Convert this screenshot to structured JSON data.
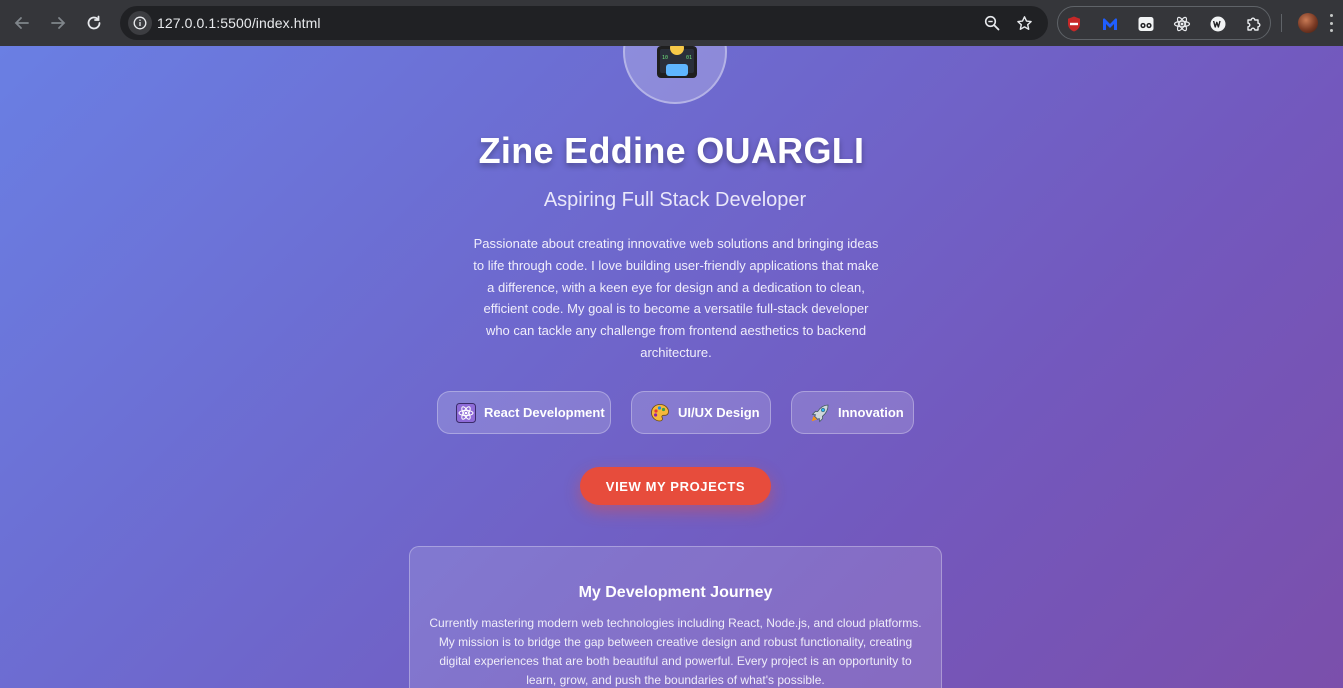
{
  "browser": {
    "url": "127.0.0.1:5500/index.html",
    "icons": {
      "back": "arrow-left-icon",
      "forward": "arrow-right-icon",
      "reload": "reload-icon",
      "site_info": "info-icon",
      "zoom": "zoom-icon",
      "bookmark": "star-icon",
      "extensions": [
        "adblock-icon",
        "malwarebytes-icon",
        "eyes-extension-icon",
        "react-devtools-icon",
        "w-extension-icon",
        "puzzle-icon"
      ],
      "profile": "avatar",
      "menu": "kebab-menu-icon"
    }
  },
  "hero": {
    "avatar_emoji": "technologist-emoji",
    "name": "Zine Eddine OUARGLI",
    "title": "Aspiring Full Stack Developer",
    "description": "Passionate about creating innovative web solutions and bringing ideas to life through code. I love building user-friendly applications that make a difference, with a keen eye for design and a dedication to clean, efficient code. My goal is to become a versatile full-stack developer who can tackle any challenge from frontend aesthetics to backend architecture."
  },
  "skills": [
    {
      "icon": "atom-icon",
      "label": "React Development"
    },
    {
      "icon": "palette-icon",
      "label": "UI/UX Design"
    },
    {
      "icon": "rocket-icon",
      "label": "Innovation"
    }
  ],
  "cta": {
    "label": "VIEW MY PROJECTS"
  },
  "journey": {
    "title": "My Development Journey",
    "text": "Currently mastering modern web technologies including React, Node.js, and cloud platforms. My mission is to bridge the gap between creative design and robust functionality, creating digital experiences that are both beautiful and powerful. Every project is an opportunity to learn, grow, and push the boundaries of what's possible."
  },
  "colors": {
    "gradient_start": "#6a7fe3",
    "gradient_end": "#7b4fab",
    "cta": "#e74c3c",
    "chrome_bg": "#35363a",
    "omnibox_bg": "#202124"
  }
}
